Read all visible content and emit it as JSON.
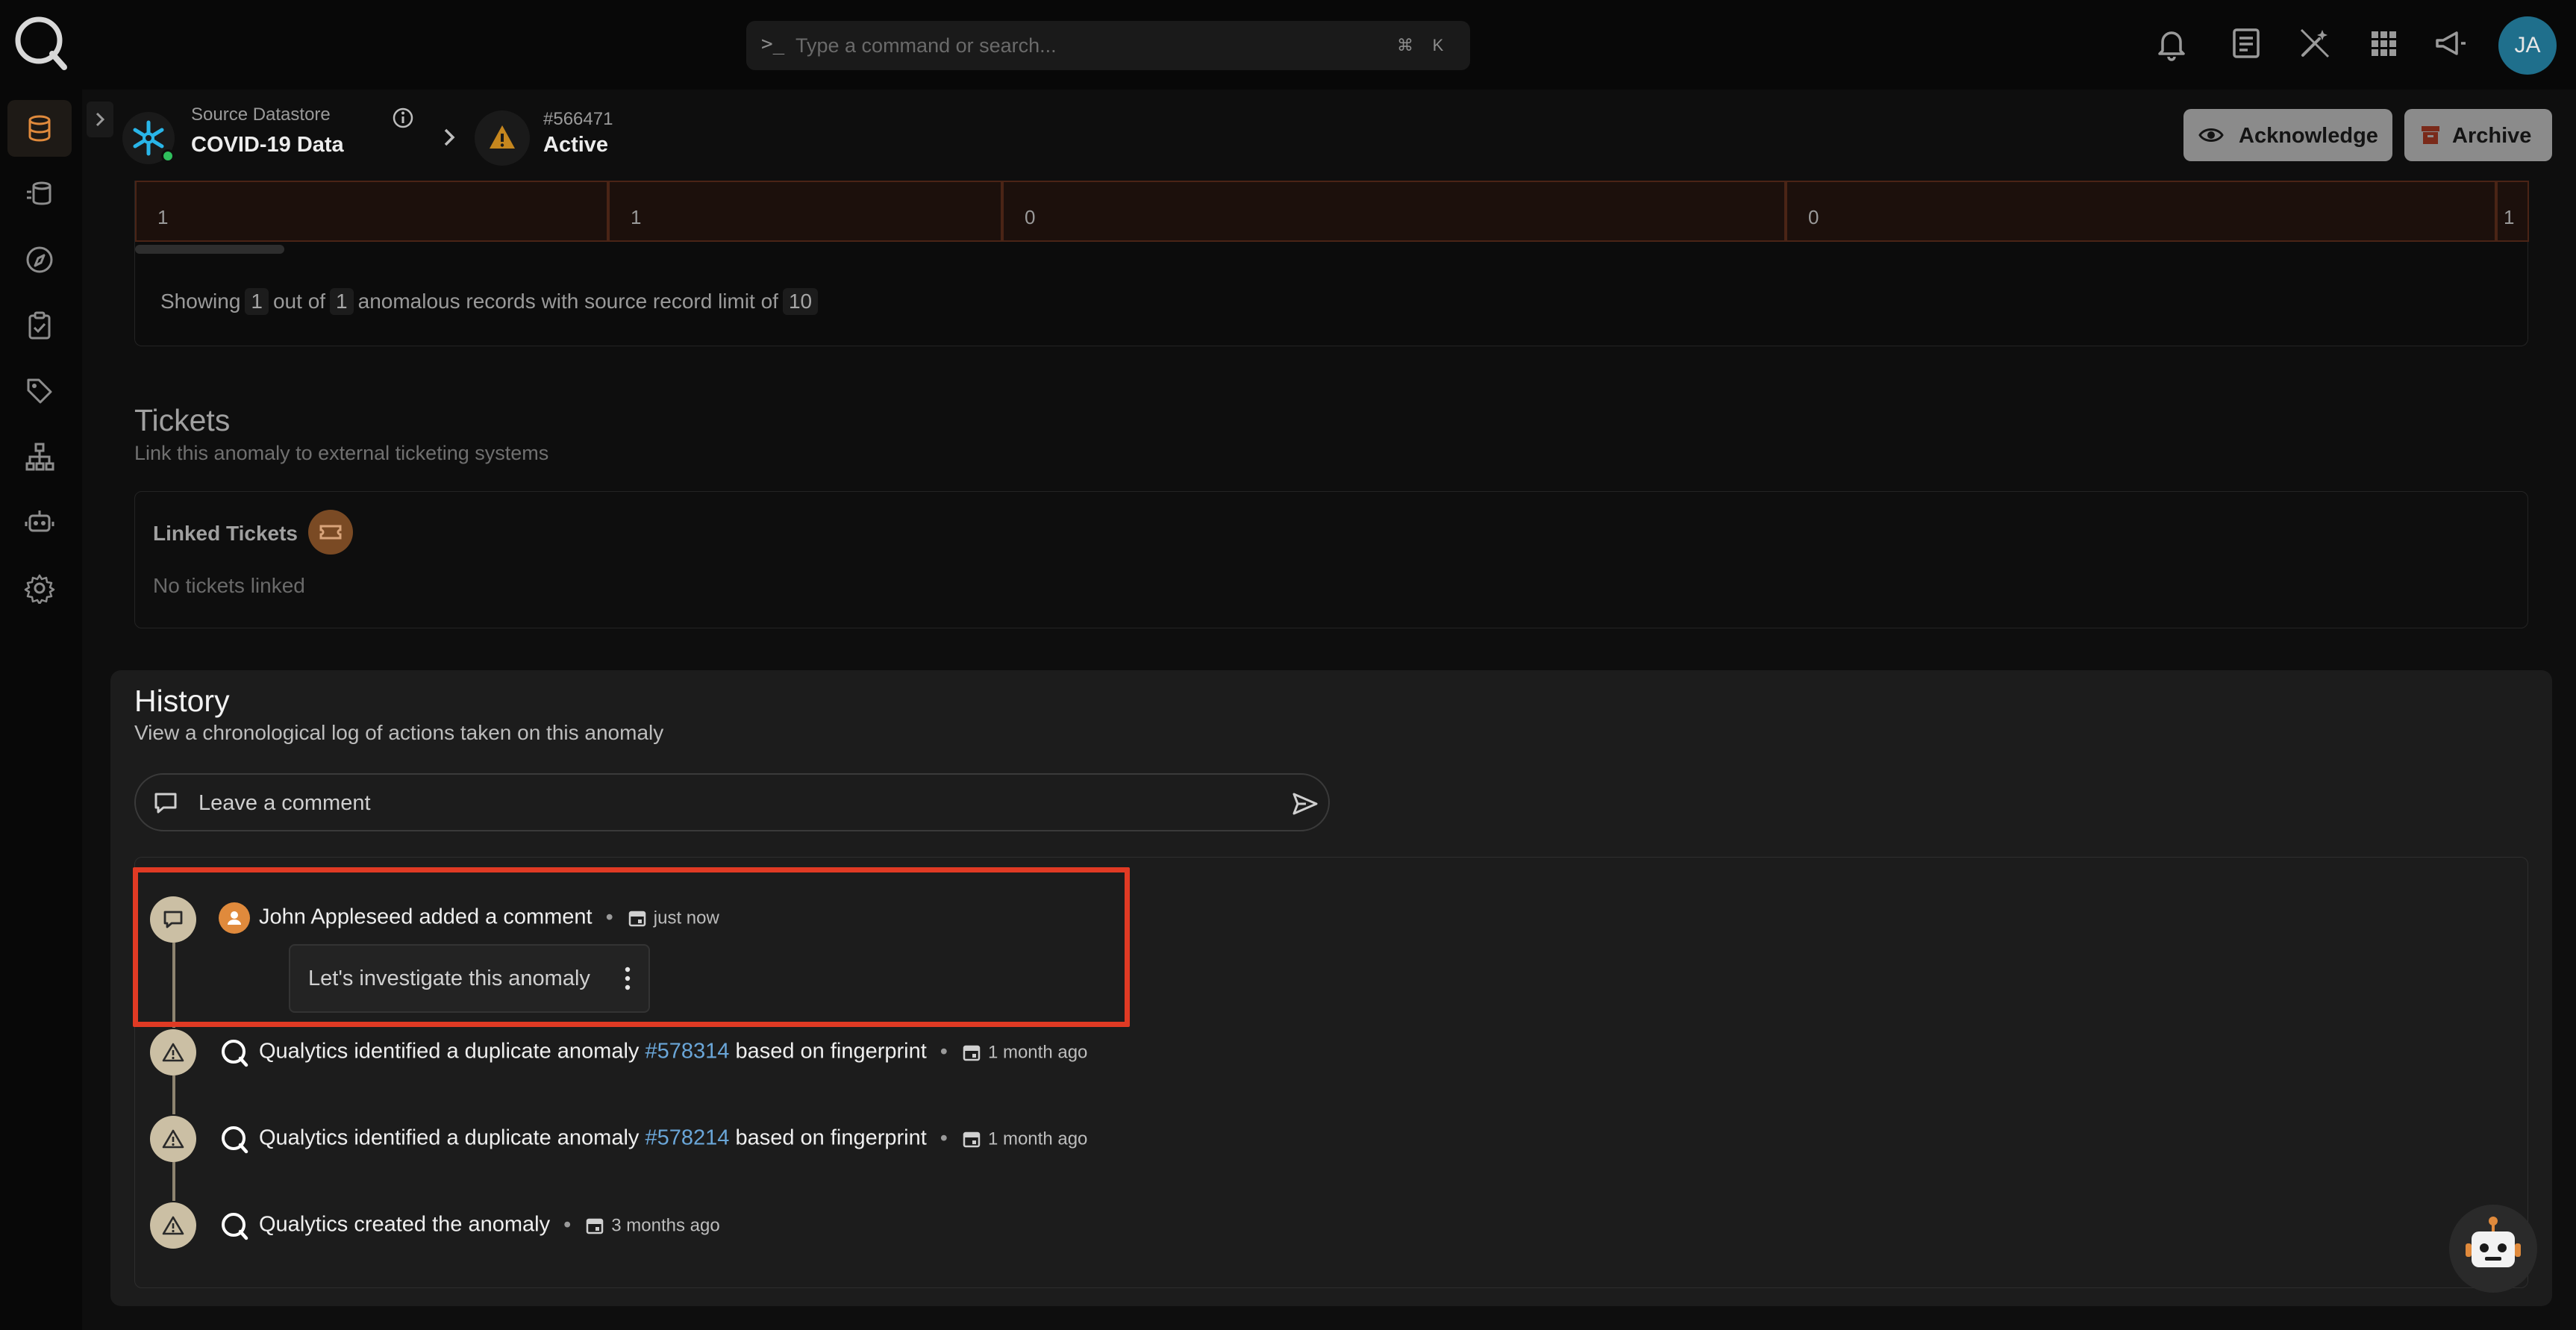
{
  "topbar": {
    "search_prompt": ">_",
    "search_placeholder": "Type a command or search...",
    "shortcut_modifier": "⌘",
    "shortcut_key": "K",
    "user_initials": "JA"
  },
  "header": {
    "datastore_label": "Source Datastore",
    "datastore_name": "COVID-19 Data",
    "anomaly_id": "#566471",
    "anomaly_status": "Active",
    "acknowledge_label": "Acknowledge",
    "archive_label": "Archive"
  },
  "records": {
    "cells": [
      "1",
      "1",
      "0",
      "0",
      "1"
    ],
    "showing_prefix": "Showing",
    "shown_count": "1",
    "out_of": "out of",
    "total_count": "1",
    "suffix": "anomalous records with source record limit of",
    "limit": "10"
  },
  "tickets": {
    "title": "Tickets",
    "subtitle": "Link this anomaly to external ticketing systems",
    "linked_label": "Linked Tickets",
    "empty_text": "No tickets linked"
  },
  "history": {
    "title": "History",
    "subtitle": "View a chronological log of actions taken on this anomaly",
    "comment_placeholder": "Leave a comment",
    "events": [
      {
        "actor": "John Appleseed",
        "action": "added a comment",
        "time": "just now",
        "comment": "Let's investigate this anomaly"
      },
      {
        "actor": "Qualytics",
        "action": "identified a duplicate anomaly",
        "link": "#578314",
        "suffix": "based on fingerprint",
        "time": "1 month ago"
      },
      {
        "actor": "Qualytics",
        "action": "identified a duplicate anomaly",
        "link": "#578214",
        "suffix": "based on fingerprint",
        "time": "1 month ago"
      },
      {
        "actor": "Qualytics",
        "action": "created the anomaly",
        "time": "3 months ago"
      }
    ]
  },
  "colors": {
    "accent": "#e08a3c",
    "highlight": "#e03a24",
    "link": "#6aa6d8",
    "active_green": "#2fbf5d",
    "avatar_bg": "#1f6f8c"
  }
}
